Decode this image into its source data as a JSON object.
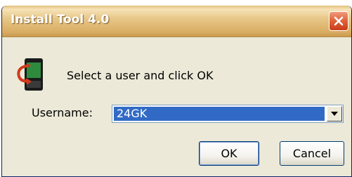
{
  "window": {
    "title": "Install Tool 4.0"
  },
  "icons": {
    "close": "close-icon",
    "app": "device-install-icon",
    "dropdown": "chevron-down-icon"
  },
  "dialog": {
    "prompt": "Select a user and click OK",
    "username_label": "Username:",
    "username_value": "24GK"
  },
  "buttons": {
    "ok": "OK",
    "cancel": "Cancel"
  },
  "colors": {
    "titlebar": "#d9ad63",
    "close_button": "#e0603a",
    "dialog_background": "#ece9d8",
    "selection": "#316ac5"
  }
}
